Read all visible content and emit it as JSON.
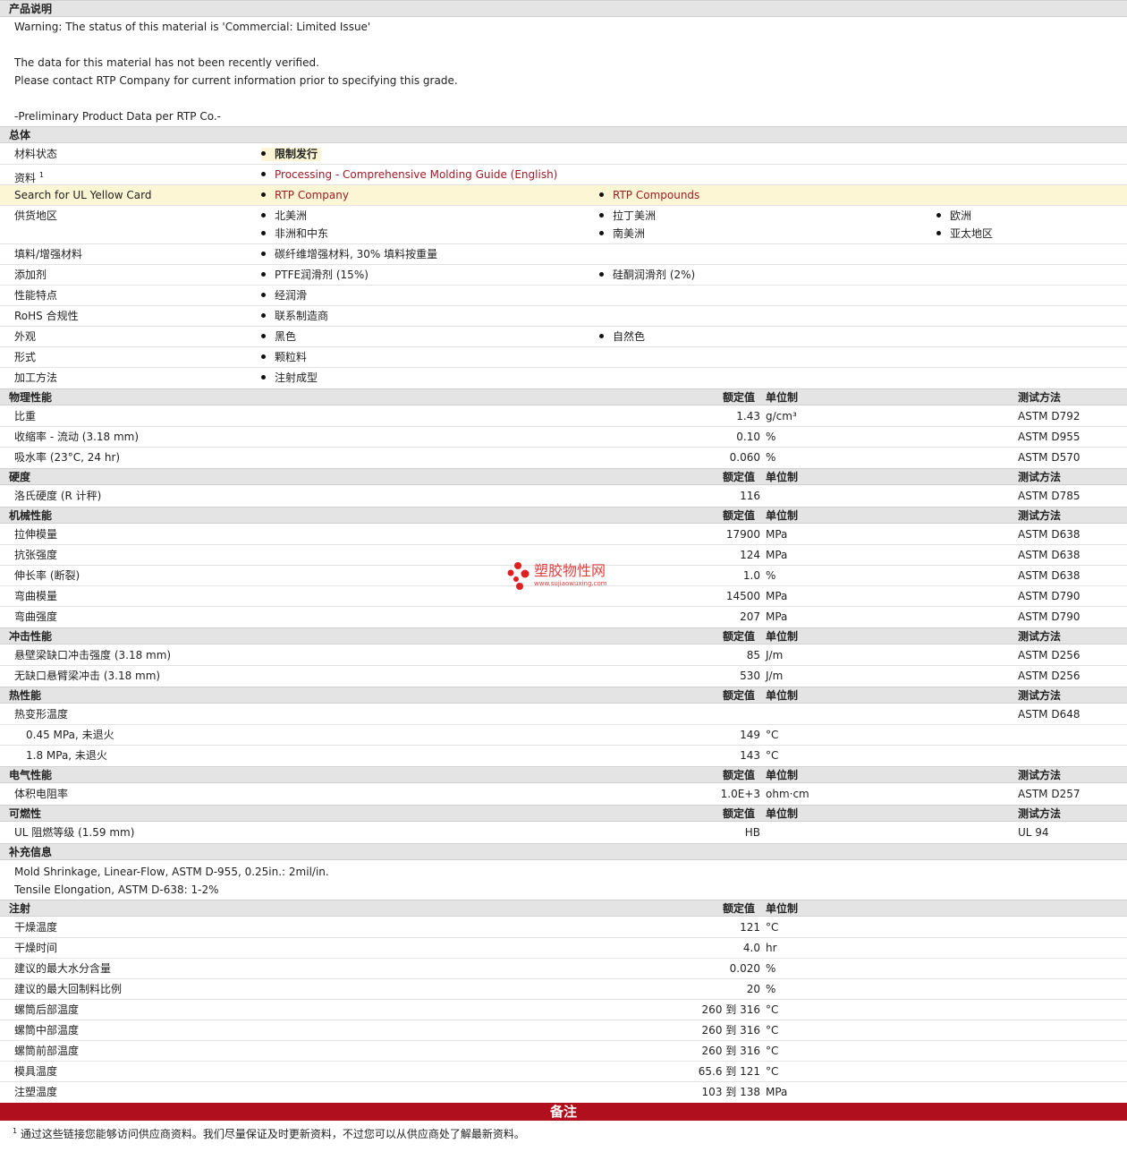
{
  "product_desc": {
    "title": "产品说明",
    "lines": [
      "Warning: The status of this material is 'Commercial: Limited Issue'",
      "",
      "The data for this material has not been recently verified.",
      "Please contact RTP Company for current information prior to specifying this grade.",
      "",
      "-Preliminary Product Data per RTP Co.-"
    ]
  },
  "general": {
    "title": "总体",
    "rows": [
      {
        "label": "材料状态",
        "items": [
          "限制发行"
        ]
      },
      {
        "label": "资料",
        "sup": "1",
        "items": [
          "Processing - Comprehensive Molding Guide (English)"
        ]
      },
      {
        "label": "Search for UL Yellow Card",
        "items": [
          "RTP Company",
          "RTP Compounds"
        ]
      },
      {
        "label": "供货地区",
        "items": [
          "北美洲",
          "拉丁美洲",
          "欧洲",
          "非洲和中东",
          "南美洲",
          "亚太地区"
        ]
      },
      {
        "label": "填料/增强材料",
        "items": [
          "碳纤维增强材料, 30% 填料按重量"
        ]
      },
      {
        "label": "添加剂",
        "items": [
          "PTFE润滑剂  (15%)",
          "硅酮润滑剂  (2%)"
        ]
      },
      {
        "label": "性能特点",
        "items": [
          "经润滑"
        ]
      },
      {
        "label": "RoHS 合规性",
        "items": [
          "联系制造商"
        ]
      },
      {
        "label": "外观",
        "items": [
          "黑色",
          "自然色"
        ]
      },
      {
        "label": "形式",
        "items": [
          "颗粒料"
        ]
      },
      {
        "label": "加工方法",
        "items": [
          "注射成型"
        ]
      }
    ]
  },
  "headers": {
    "nominal": "额定值",
    "unit": "单位制",
    "test": "测试方法"
  },
  "physical": {
    "title": "物理性能",
    "rows": [
      {
        "label": "比重",
        "value": "1.43",
        "unit": "g/cm³",
        "test": "ASTM D792"
      },
      {
        "label": "收缩率  - 流动  (3.18 mm)",
        "value": "0.10",
        "unit": "%",
        "test": "ASTM D955"
      },
      {
        "label": "吸水率  (23°C, 24 hr)",
        "value": "0.060",
        "unit": "%",
        "test": "ASTM D570"
      }
    ]
  },
  "hardness": {
    "title": "硬度",
    "rows": [
      {
        "label": "洛氏硬度  (R 计秤)",
        "value": "116",
        "unit": "",
        "test": "ASTM D785"
      }
    ]
  },
  "mechanical": {
    "title": "机械性能",
    "rows": [
      {
        "label": "拉伸模量",
        "value": "17900",
        "unit": "MPa",
        "test": "ASTM D638"
      },
      {
        "label": "抗张强度",
        "value": "124",
        "unit": "MPa",
        "test": "ASTM D638"
      },
      {
        "label": "伸长率  (断裂)",
        "value": "1.0",
        "unit": "%",
        "test": "ASTM D638"
      },
      {
        "label": "弯曲模量",
        "value": "14500",
        "unit": "MPa",
        "test": "ASTM D790"
      },
      {
        "label": "弯曲强度",
        "value": "207",
        "unit": "MPa",
        "test": "ASTM D790"
      }
    ]
  },
  "impact": {
    "title": "冲击性能",
    "rows": [
      {
        "label": "悬壁梁缺口冲击强度  (3.18 mm)",
        "value": "85",
        "unit": "J/m",
        "test": "ASTM D256"
      },
      {
        "label": "无缺口悬臂梁冲击  (3.18 mm)",
        "value": "530",
        "unit": "J/m",
        "test": "ASTM D256"
      }
    ]
  },
  "thermal": {
    "title": "热性能",
    "rows": [
      {
        "label": "热变形温度",
        "value": "",
        "unit": "",
        "test": "ASTM D648"
      },
      {
        "label": "0.45 MPa, 未退火",
        "value": "149",
        "unit": "°C",
        "test": ""
      },
      {
        "label": "1.8 MPa, 未退火",
        "value": "143",
        "unit": "°C",
        "test": ""
      }
    ]
  },
  "electrical": {
    "title": "电气性能",
    "rows": [
      {
        "label": "体积电阻率",
        "value": "1.0E+3",
        "unit": "ohm·cm",
        "test": "ASTM D257"
      }
    ]
  },
  "flammability": {
    "title": "可燃性",
    "rows": [
      {
        "label": "UL 阻燃等级  (1.59 mm)",
        "value": "HB",
        "unit": "",
        "test": "UL 94"
      }
    ]
  },
  "supplement": {
    "title": "补充信息",
    "lines": [
      "Mold Shrinkage, Linear-Flow, ASTM D-955, 0.25in.: 2mil/in.",
      "Tensile Elongation, ASTM D-638: 1-2%"
    ]
  },
  "injection": {
    "title": "注射",
    "rows": [
      {
        "label": "干燥温度",
        "value": "121",
        "unit": "°C"
      },
      {
        "label": "干燥时间",
        "value": "4.0",
        "unit": "hr"
      },
      {
        "label": "建议的最大水分含量",
        "value": "0.020",
        "unit": "%"
      },
      {
        "label": "建议的最大回制料比例",
        "value": "20",
        "unit": "%"
      },
      {
        "label": "螺筒后部温度",
        "value": "260 到  316",
        "unit": "°C"
      },
      {
        "label": "螺筒中部温度",
        "value": "260 到  316",
        "unit": "°C"
      },
      {
        "label": "螺筒前部温度",
        "value": "260 到  316",
        "unit": "°C"
      },
      {
        "label": "模具温度",
        "value": "65.6 到  121",
        "unit": "°C"
      },
      {
        "label": "注塑温度",
        "value": "103 到  138",
        "unit": "MPa"
      }
    ]
  },
  "remarks": {
    "title": "备注",
    "sup": "1",
    "note": "通过这些链接您能够访问供应商资料。我们尽量保证及时更新资料，不过您可以从供应商处了解最新资料。"
  },
  "watermark": {
    "brand": "塑胶物性网",
    "url": "www.sujiaowuxing.com"
  },
  "colors": {
    "link": "#9c1b27",
    "section_bg": "#e4e4e4",
    "highlight_bg": "#fcf6d4",
    "remarks_bg": "#b0101e"
  }
}
